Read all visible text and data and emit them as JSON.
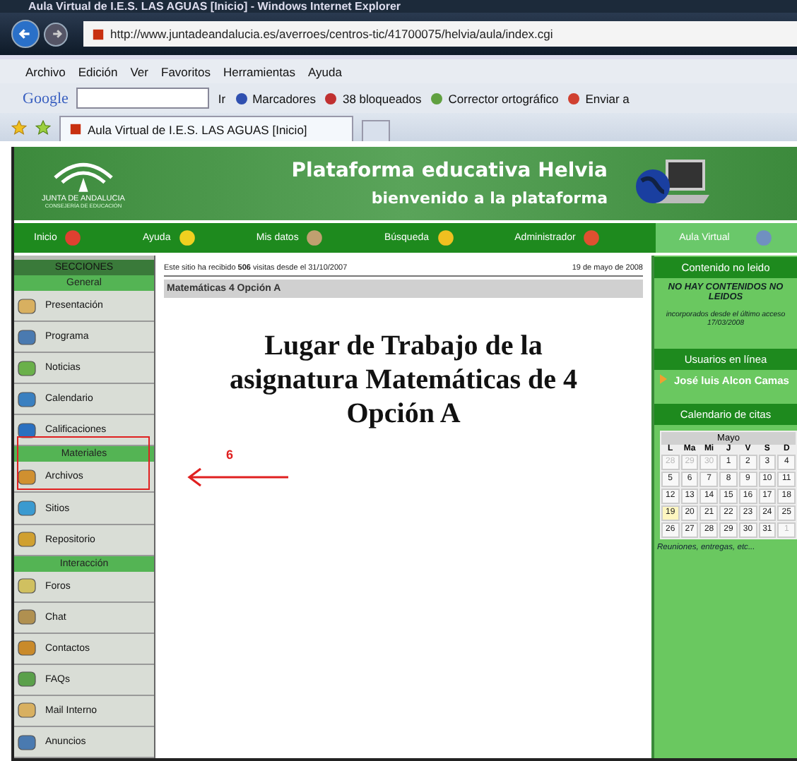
{
  "window": {
    "title": "Aula Virtual de I.E.S. LAS AGUAS [Inicio] - Windows Internet Explorer"
  },
  "address_bar": {
    "url": "http://www.juntadeandalucia.es/averroes/centros-tic/41700075/helvia/aula/index.cgi"
  },
  "menu": [
    "Archivo",
    "Edición",
    "Ver",
    "Favoritos",
    "Herramientas",
    "Ayuda"
  ],
  "toolbar": {
    "brand": "Google",
    "go": "Ir",
    "items": [
      "Marcadores",
      "38 bloqueados",
      "Corrector ortográfico",
      "Enviar a"
    ]
  },
  "tabs": [
    {
      "label": "Aula Virtual de I.E.S. LAS AGUAS [Inicio]",
      "selected": true
    }
  ],
  "banner": {
    "logo_line1": "JUNTA DE ANDALUCIA",
    "logo_line2": "CONSEJERÍA DE EDUCACIÓN",
    "title": "Plataforma educativa Helvia",
    "subtitle": "bienvenido a la plataforma"
  },
  "nav": [
    {
      "label": "Inicio",
      "selected": false
    },
    {
      "label": "Ayuda",
      "selected": false
    },
    {
      "label": "Mis datos",
      "selected": false
    },
    {
      "label": "Búsqueda",
      "selected": false
    },
    {
      "label": "Administrador",
      "selected": false
    },
    {
      "label": "Aula Virtual",
      "selected": true
    }
  ],
  "sidebar": {
    "items": [
      {
        "kind": "title",
        "label": "SECCIONES"
      },
      {
        "kind": "group",
        "label": "General"
      },
      {
        "kind": "item",
        "label": "Presentación"
      },
      {
        "kind": "item",
        "label": "Programa"
      },
      {
        "kind": "item",
        "label": "Noticias"
      },
      {
        "kind": "item",
        "label": "Calendario"
      },
      {
        "kind": "item",
        "label": "Calificaciones"
      },
      {
        "kind": "group",
        "label": "Materiales"
      },
      {
        "kind": "item",
        "label": "Archivos"
      },
      {
        "kind": "item",
        "label": "Sitios"
      },
      {
        "kind": "item",
        "label": "Repositorio"
      },
      {
        "kind": "group",
        "label": "Interacción"
      },
      {
        "kind": "item",
        "label": "Foros"
      },
      {
        "kind": "item",
        "label": "Chat"
      },
      {
        "kind": "item",
        "label": "Contactos"
      },
      {
        "kind": "item",
        "label": "FAQs"
      },
      {
        "kind": "item",
        "label": "Mail Interno"
      },
      {
        "kind": "item",
        "label": "Anuncios"
      }
    ]
  },
  "main": {
    "visits": "Este sitio ha recibido **506** visitas desde el 31/10/2007",
    "date": "19 de mayo de 2008",
    "breadcrumb": "Matemáticas 4 Opción A",
    "heading": "Lugar de Trabajo de la asignatura Matemáticas de 4 Opción A"
  },
  "annotation": {
    "label": "6"
  },
  "right_panel": {
    "unread": {
      "title": "Contenido no leido",
      "message": "NO HAY CONTENIDOS NO LEIDOS",
      "note": "incorporados desde el último acceso 17/03/2008"
    },
    "online": {
      "title": "Usuarios en línea",
      "users": [
        "José luis Alcon Camas"
      ]
    },
    "calendar": {
      "title": "Calendario de citas",
      "month": "Mayo",
      "weekdays": [
        "L",
        "Ma",
        "Mi",
        "J",
        "V",
        "S",
        "D"
      ],
      "weeks": [
        [
          {
            "day": "28",
            "outside": true,
            "selected": false
          },
          {
            "day": "29",
            "outside": true,
            "selected": false
          },
          {
            "day": "30",
            "outside": true,
            "selected": false
          },
          {
            "day": "1",
            "outside": false,
            "selected": false
          },
          {
            "day": "2",
            "outside": false,
            "selected": false
          },
          {
            "day": "3",
            "outside": false,
            "selected": false
          },
          {
            "day": "4",
            "outside": false,
            "selected": false
          }
        ],
        [
          {
            "day": "5",
            "outside": false,
            "selected": false
          },
          {
            "day": "6",
            "outside": false,
            "selected": false
          },
          {
            "day": "7",
            "outside": false,
            "selected": false
          },
          {
            "day": "8",
            "outside": false,
            "selected": false
          },
          {
            "day": "9",
            "outside": false,
            "selected": false
          },
          {
            "day": "10",
            "outside": false,
            "selected": false
          },
          {
            "day": "11",
            "outside": false,
            "selected": false
          }
        ],
        [
          {
            "day": "12",
            "outside": false,
            "selected": false
          },
          {
            "day": "13",
            "outside": false,
            "selected": false
          },
          {
            "day": "14",
            "outside": false,
            "selected": false
          },
          {
            "day": "15",
            "outside": false,
            "selected": false
          },
          {
            "day": "16",
            "outside": false,
            "selected": false
          },
          {
            "day": "17",
            "outside": false,
            "selected": false
          },
          {
            "day": "18",
            "outside": false,
            "selected": false
          }
        ],
        [
          {
            "day": "19",
            "outside": false,
            "selected": true
          },
          {
            "day": "20",
            "outside": false,
            "selected": false
          },
          {
            "day": "21",
            "outside": false,
            "selected": false
          },
          {
            "day": "22",
            "outside": false,
            "selected": false
          },
          {
            "day": "23",
            "outside": false,
            "selected": false
          },
          {
            "day": "24",
            "outside": false,
            "selected": false
          },
          {
            "day": "25",
            "outside": false,
            "selected": false
          }
        ],
        [
          {
            "day": "26",
            "outside": false,
            "selected": false
          },
          {
            "day": "27",
            "outside": false,
            "selected": false
          },
          {
            "day": "28",
            "outside": false,
            "selected": false
          },
          {
            "day": "29",
            "outside": false,
            "selected": false
          },
          {
            "day": "30",
            "outside": false,
            "selected": false
          },
          {
            "day": "31",
            "outside": false,
            "selected": false
          },
          {
            "day": "1",
            "outside": true,
            "selected": false
          }
        ]
      ],
      "footer": "Reuniones, entregas, etc..."
    }
  }
}
